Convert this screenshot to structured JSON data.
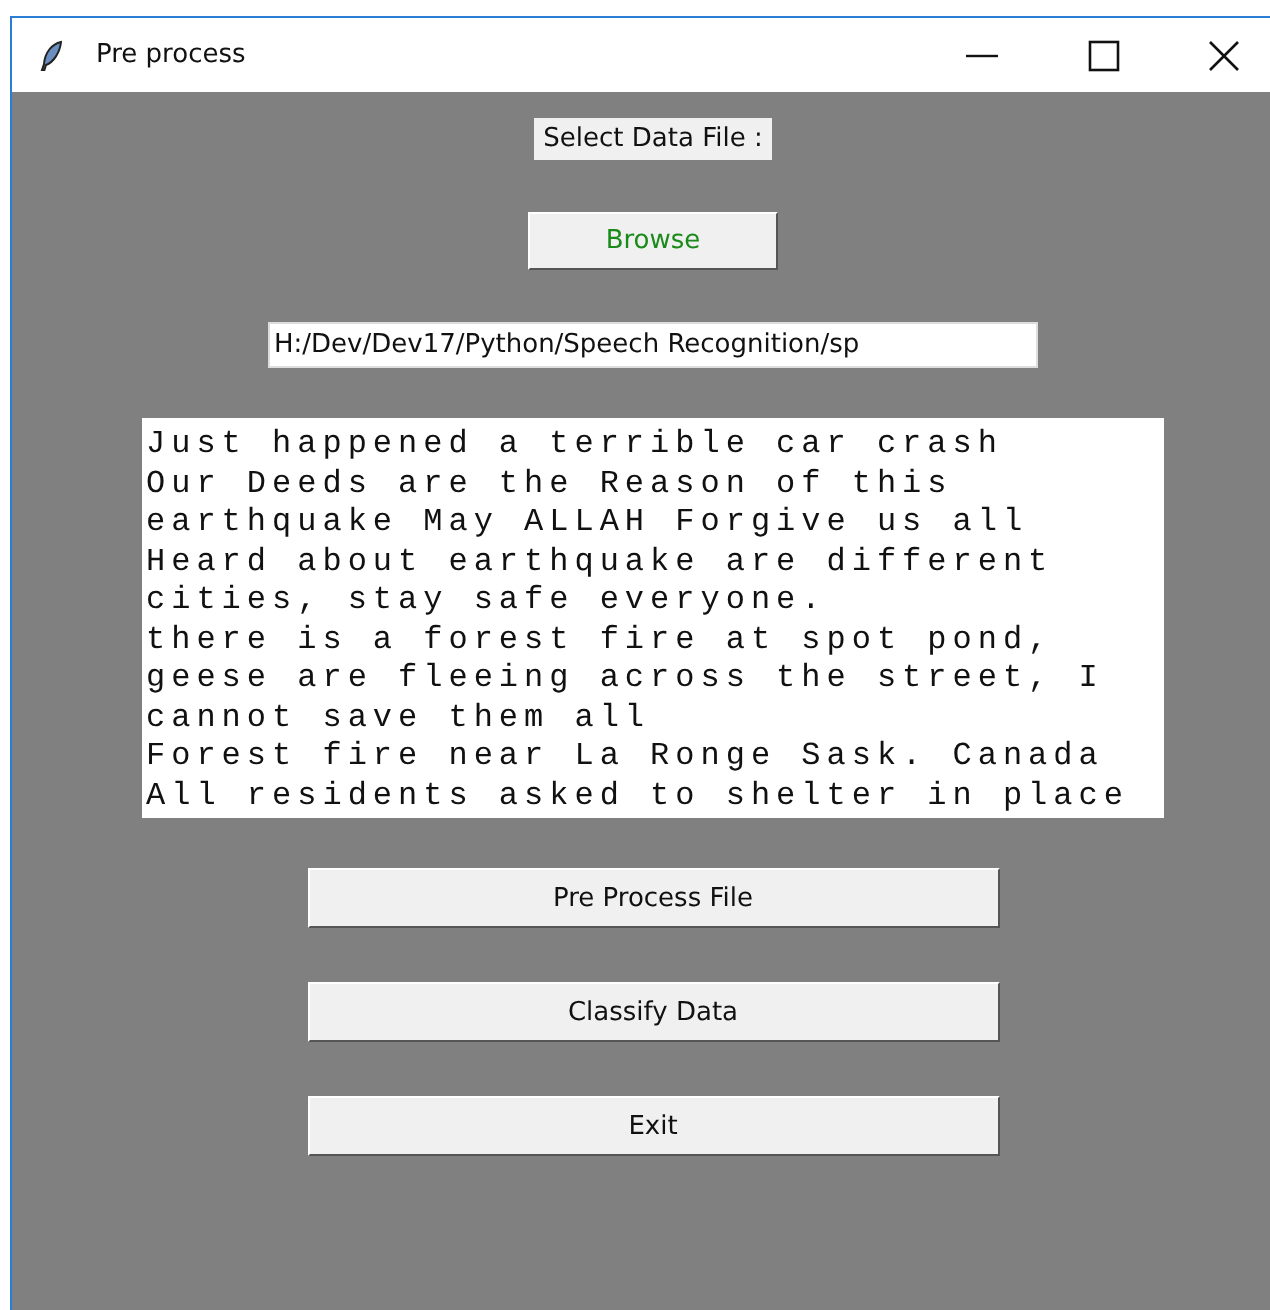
{
  "window": {
    "title": "Pre process"
  },
  "select_label": "Select Data File :",
  "browse_button": "Browse",
  "file_path": {
    "value": "H:/Dev/Dev17/Python/Speech Recognition/sp"
  },
  "text_area": {
    "lines": [
      "Just happened a terrible car crash",
      "Our Deeds are the Reason of this",
      "earthquake May ALLAH Forgive us all",
      "Heard about earthquake are different",
      "cities, stay safe everyone.",
      "there is a forest fire at spot pond,",
      "geese are fleeing across the street, I",
      "cannot save them all",
      "Forest fire near La Ronge Sask. Canada",
      "All residents asked to shelter in place"
    ]
  },
  "buttons": [
    "Pre Process File",
    "Classify Data",
    "Exit"
  ]
}
